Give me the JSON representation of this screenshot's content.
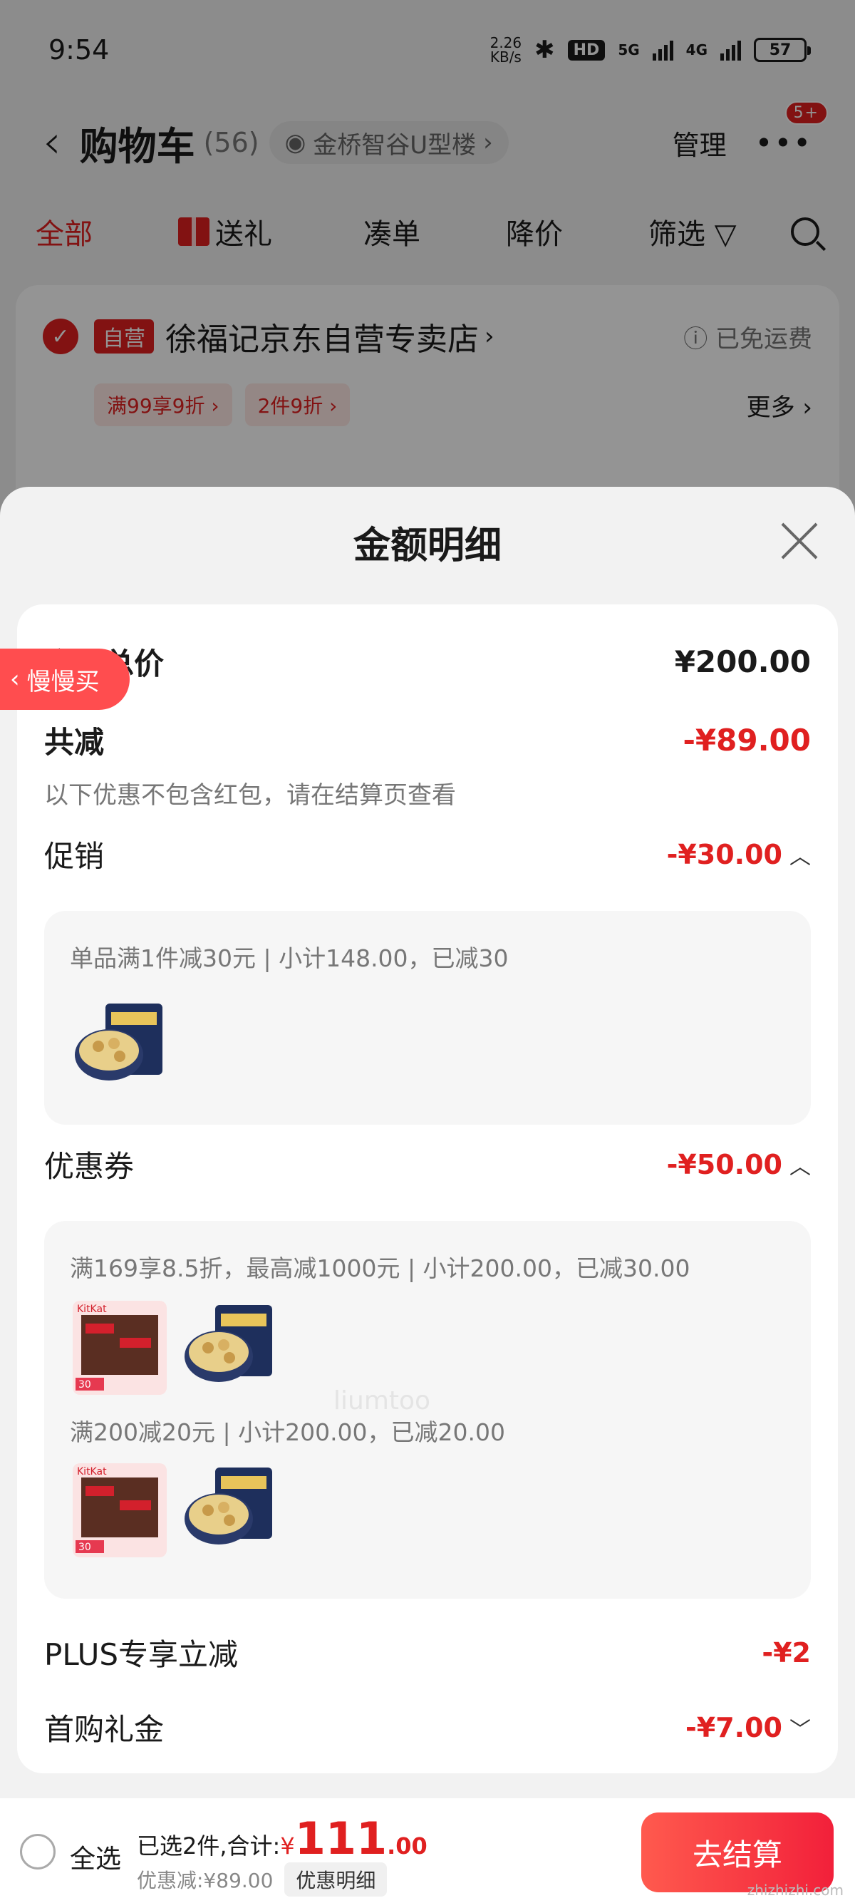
{
  "status_bar": {
    "time": "9:54",
    "speed_value": "2.26",
    "speed_unit": "KB/s",
    "hd_label": "HD",
    "net_5g": "5G",
    "net_4g": "4G",
    "battery": "57"
  },
  "nav": {
    "title": "购物车",
    "count": "(56)",
    "address": "金桥智谷U型楼",
    "manage": "管理",
    "more_badge": "5+"
  },
  "tabs": [
    "全部",
    "送礼",
    "凑单",
    "降价",
    "筛选"
  ],
  "store": {
    "self_tag": "自营",
    "name": "徐福记京东自营专卖店",
    "shipping": "已免运费",
    "promos": [
      "满99享9折",
      "2件9折"
    ],
    "more": "更多"
  },
  "sheet": {
    "title": "金额明细",
    "total_label": "商品总价",
    "total_value": "¥200.00",
    "discount_label": "共减",
    "discount_value": "-¥89.00",
    "note": "以下优惠不包含红包，请在结算页查看",
    "promo_label": "促销",
    "promo_value": "-¥30.00",
    "promo_detail": "单品满1件减30元 | 小计148.00，已减30",
    "coupon_label": "优惠券",
    "coupon_value": "-¥50.00",
    "coupon_detail_1": "满169享8.5折，最高减1000元 | 小计200.00，已减30.00",
    "coupon_detail_2": "满200减20元 | 小计200.00，已减20.00",
    "plus_label": "PLUS专享立减",
    "plus_value": "-¥2",
    "first_label": "首购礼金",
    "first_value": "-¥7.00"
  },
  "float_pill": "慢慢买",
  "watermark": "liumtoo",
  "bottom": {
    "select_all": "全选",
    "summary_prefix": "已选2件,合计:",
    "currency": "¥",
    "total_int": "111",
    "total_dec": ".00",
    "saved": "优惠减:¥89.00",
    "detail_button": "优惠明细",
    "checkout": "去结算",
    "site_mark": "zhizhizhi.com"
  },
  "colors": {
    "accent_red": "#e02020",
    "checkout_gradient_start": "#ff5a4e",
    "checkout_gradient_end": "#f2203a"
  }
}
